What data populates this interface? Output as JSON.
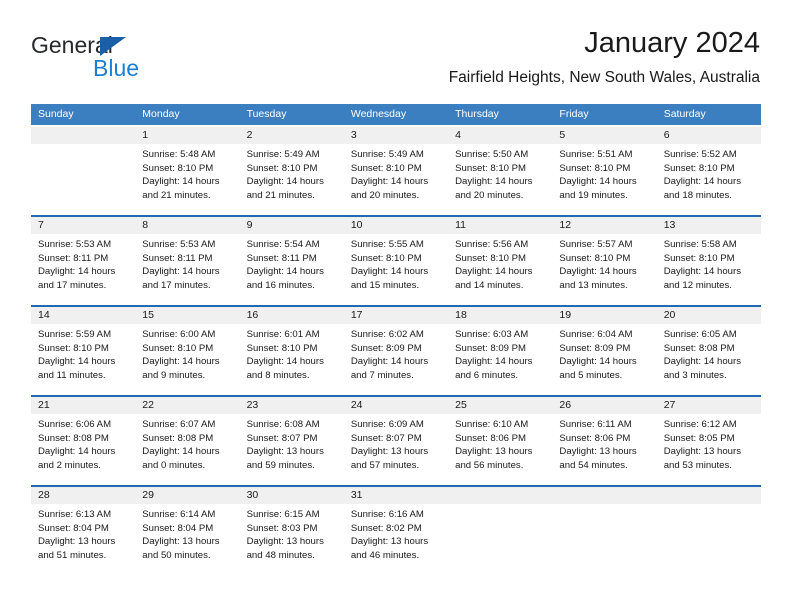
{
  "brand": {
    "name_part1": "General",
    "name_part2": "Blue"
  },
  "header": {
    "title": "January 2024",
    "subtitle": "Fairfield Heights, New South Wales, Australia"
  },
  "colors": {
    "header_blue": "#3c7fc1",
    "rule_blue": "#1f6ab0",
    "daynum_strip": "#f0f0f0",
    "logo_blue": "#1c7fd4",
    "text": "#1a1a1a"
  },
  "weekday_headers": [
    "Sunday",
    "Monday",
    "Tuesday",
    "Wednesday",
    "Thursday",
    "Friday",
    "Saturday"
  ],
  "weeks": [
    {
      "days": [
        {
          "date": "",
          "sunrise": "",
          "sunset": "",
          "daylight": "",
          "empty": true
        },
        {
          "date": "1",
          "sunrise": "Sunrise: 5:48 AM",
          "sunset": "Sunset: 8:10 PM",
          "daylight": "Daylight: 14 hours and 21 minutes."
        },
        {
          "date": "2",
          "sunrise": "Sunrise: 5:49 AM",
          "sunset": "Sunset: 8:10 PM",
          "daylight": "Daylight: 14 hours and 21 minutes."
        },
        {
          "date": "3",
          "sunrise": "Sunrise: 5:49 AM",
          "sunset": "Sunset: 8:10 PM",
          "daylight": "Daylight: 14 hours and 20 minutes."
        },
        {
          "date": "4",
          "sunrise": "Sunrise: 5:50 AM",
          "sunset": "Sunset: 8:10 PM",
          "daylight": "Daylight: 14 hours and 20 minutes."
        },
        {
          "date": "5",
          "sunrise": "Sunrise: 5:51 AM",
          "sunset": "Sunset: 8:10 PM",
          "daylight": "Daylight: 14 hours and 19 minutes."
        },
        {
          "date": "6",
          "sunrise": "Sunrise: 5:52 AM",
          "sunset": "Sunset: 8:10 PM",
          "daylight": "Daylight: 14 hours and 18 minutes."
        }
      ]
    },
    {
      "days": [
        {
          "date": "7",
          "sunrise": "Sunrise: 5:53 AM",
          "sunset": "Sunset: 8:11 PM",
          "daylight": "Daylight: 14 hours and 17 minutes."
        },
        {
          "date": "8",
          "sunrise": "Sunrise: 5:53 AM",
          "sunset": "Sunset: 8:11 PM",
          "daylight": "Daylight: 14 hours and 17 minutes."
        },
        {
          "date": "9",
          "sunrise": "Sunrise: 5:54 AM",
          "sunset": "Sunset: 8:11 PM",
          "daylight": "Daylight: 14 hours and 16 minutes."
        },
        {
          "date": "10",
          "sunrise": "Sunrise: 5:55 AM",
          "sunset": "Sunset: 8:10 PM",
          "daylight": "Daylight: 14 hours and 15 minutes."
        },
        {
          "date": "11",
          "sunrise": "Sunrise: 5:56 AM",
          "sunset": "Sunset: 8:10 PM",
          "daylight": "Daylight: 14 hours and 14 minutes."
        },
        {
          "date": "12",
          "sunrise": "Sunrise: 5:57 AM",
          "sunset": "Sunset: 8:10 PM",
          "daylight": "Daylight: 14 hours and 13 minutes."
        },
        {
          "date": "13",
          "sunrise": "Sunrise: 5:58 AM",
          "sunset": "Sunset: 8:10 PM",
          "daylight": "Daylight: 14 hours and 12 minutes."
        }
      ]
    },
    {
      "days": [
        {
          "date": "14",
          "sunrise": "Sunrise: 5:59 AM",
          "sunset": "Sunset: 8:10 PM",
          "daylight": "Daylight: 14 hours and 11 minutes."
        },
        {
          "date": "15",
          "sunrise": "Sunrise: 6:00 AM",
          "sunset": "Sunset: 8:10 PM",
          "daylight": "Daylight: 14 hours and 9 minutes."
        },
        {
          "date": "16",
          "sunrise": "Sunrise: 6:01 AM",
          "sunset": "Sunset: 8:10 PM",
          "daylight": "Daylight: 14 hours and 8 minutes."
        },
        {
          "date": "17",
          "sunrise": "Sunrise: 6:02 AM",
          "sunset": "Sunset: 8:09 PM",
          "daylight": "Daylight: 14 hours and 7 minutes."
        },
        {
          "date": "18",
          "sunrise": "Sunrise: 6:03 AM",
          "sunset": "Sunset: 8:09 PM",
          "daylight": "Daylight: 14 hours and 6 minutes."
        },
        {
          "date": "19",
          "sunrise": "Sunrise: 6:04 AM",
          "sunset": "Sunset: 8:09 PM",
          "daylight": "Daylight: 14 hours and 5 minutes."
        },
        {
          "date": "20",
          "sunrise": "Sunrise: 6:05 AM",
          "sunset": "Sunset: 8:08 PM",
          "daylight": "Daylight: 14 hours and 3 minutes."
        }
      ]
    },
    {
      "days": [
        {
          "date": "21",
          "sunrise": "Sunrise: 6:06 AM",
          "sunset": "Sunset: 8:08 PM",
          "daylight": "Daylight: 14 hours and 2 minutes."
        },
        {
          "date": "22",
          "sunrise": "Sunrise: 6:07 AM",
          "sunset": "Sunset: 8:08 PM",
          "daylight": "Daylight: 14 hours and 0 minutes."
        },
        {
          "date": "23",
          "sunrise": "Sunrise: 6:08 AM",
          "sunset": "Sunset: 8:07 PM",
          "daylight": "Daylight: 13 hours and 59 minutes."
        },
        {
          "date": "24",
          "sunrise": "Sunrise: 6:09 AM",
          "sunset": "Sunset: 8:07 PM",
          "daylight": "Daylight: 13 hours and 57 minutes."
        },
        {
          "date": "25",
          "sunrise": "Sunrise: 6:10 AM",
          "sunset": "Sunset: 8:06 PM",
          "daylight": "Daylight: 13 hours and 56 minutes."
        },
        {
          "date": "26",
          "sunrise": "Sunrise: 6:11 AM",
          "sunset": "Sunset: 8:06 PM",
          "daylight": "Daylight: 13 hours and 54 minutes."
        },
        {
          "date": "27",
          "sunrise": "Sunrise: 6:12 AM",
          "sunset": "Sunset: 8:05 PM",
          "daylight": "Daylight: 13 hours and 53 minutes."
        }
      ]
    },
    {
      "days": [
        {
          "date": "28",
          "sunrise": "Sunrise: 6:13 AM",
          "sunset": "Sunset: 8:04 PM",
          "daylight": "Daylight: 13 hours and 51 minutes."
        },
        {
          "date": "29",
          "sunrise": "Sunrise: 6:14 AM",
          "sunset": "Sunset: 8:04 PM",
          "daylight": "Daylight: 13 hours and 50 minutes."
        },
        {
          "date": "30",
          "sunrise": "Sunrise: 6:15 AM",
          "sunset": "Sunset: 8:03 PM",
          "daylight": "Daylight: 13 hours and 48 minutes."
        },
        {
          "date": "31",
          "sunrise": "Sunrise: 6:16 AM",
          "sunset": "Sunset: 8:02 PM",
          "daylight": "Daylight: 13 hours and 46 minutes."
        },
        {
          "date": "",
          "sunrise": "",
          "sunset": "",
          "daylight": "",
          "empty": true
        },
        {
          "date": "",
          "sunrise": "",
          "sunset": "",
          "daylight": "",
          "empty": true
        },
        {
          "date": "",
          "sunrise": "",
          "sunset": "",
          "daylight": "",
          "empty": true
        }
      ]
    }
  ]
}
